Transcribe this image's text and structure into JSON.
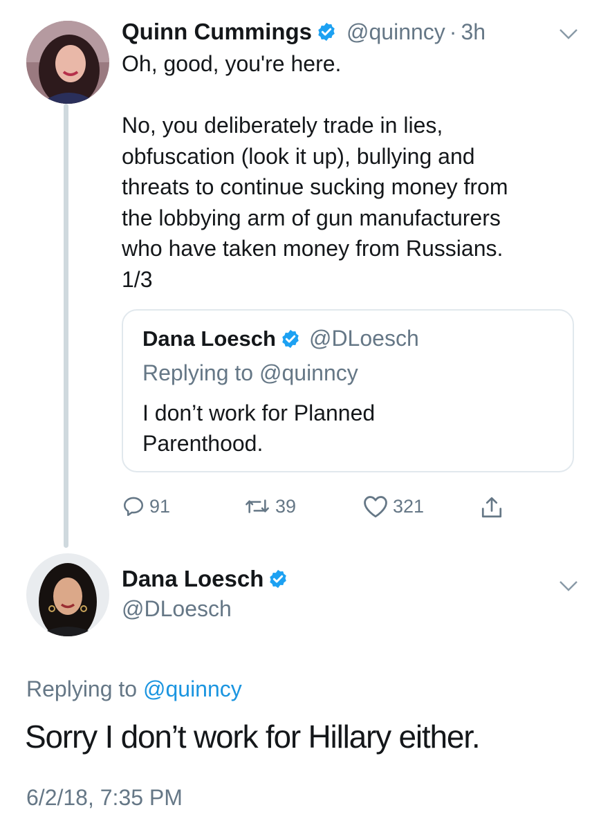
{
  "tweet1": {
    "name": "Quinn Cummings",
    "handle": "@quinncy",
    "separator": "·",
    "time": "3h",
    "lines": [
      "Oh, good, you're here.",
      "No, you deliberately trade in lies,",
      "obfuscation (look it up), bullying and",
      "threats to continue sucking money from",
      "the lobbying arm of gun manufacturers",
      "who have taken money from Russians.",
      "1/3"
    ],
    "quote": {
      "name": "Dana Loesch",
      "handle": "@DLoesch",
      "replying_prefix": "Replying to",
      "replying_handle": "@quinncy",
      "lines": [
        "I don’t work for Planned",
        "Parenthood."
      ]
    },
    "actions": {
      "replies": "91",
      "retweets": "39",
      "likes": "321"
    }
  },
  "tweet2": {
    "name": "Dana Loesch",
    "handle": "@DLoesch",
    "replying_prefix": "Replying to",
    "replying_handle": "@quinncy",
    "text": "Sorry I don’t work for Hillary either.",
    "timestamp": "6/2/18, 7:35 PM"
  },
  "colors": {
    "verified_blue": "#1da1f2",
    "link_blue": "#1b95e0",
    "secondary_gray": "#657786",
    "thread_line": "#cfd9de",
    "border": "#e1e8ed"
  },
  "icons": [
    "verified-badge-icon",
    "chevron-down-icon",
    "reply-icon",
    "retweet-icon",
    "like-icon",
    "share-icon"
  ]
}
